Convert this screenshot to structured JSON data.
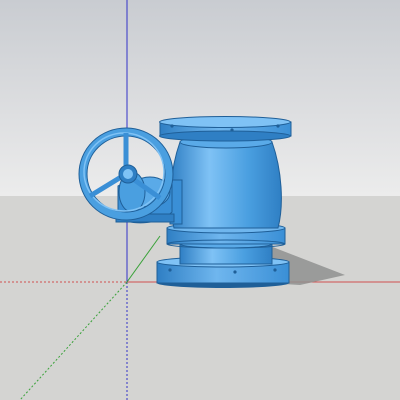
{
  "viewport": {
    "sky_top_color": "#c9ccd1",
    "sky_bottom_color": "#ececec",
    "ground_color": "#d4d4d2",
    "axis_colors": {
      "red": "#d05050",
      "green": "#3aa23a",
      "blue": "#3232c8"
    }
  },
  "model": {
    "name": "gear-operated-valve",
    "body_color": "#4a9fe0",
    "shade_color": "#2f7fc4",
    "dark_color": "#1f5f98",
    "highlight_color": "#7fc2f5",
    "shadow_color": "#8f9190"
  }
}
